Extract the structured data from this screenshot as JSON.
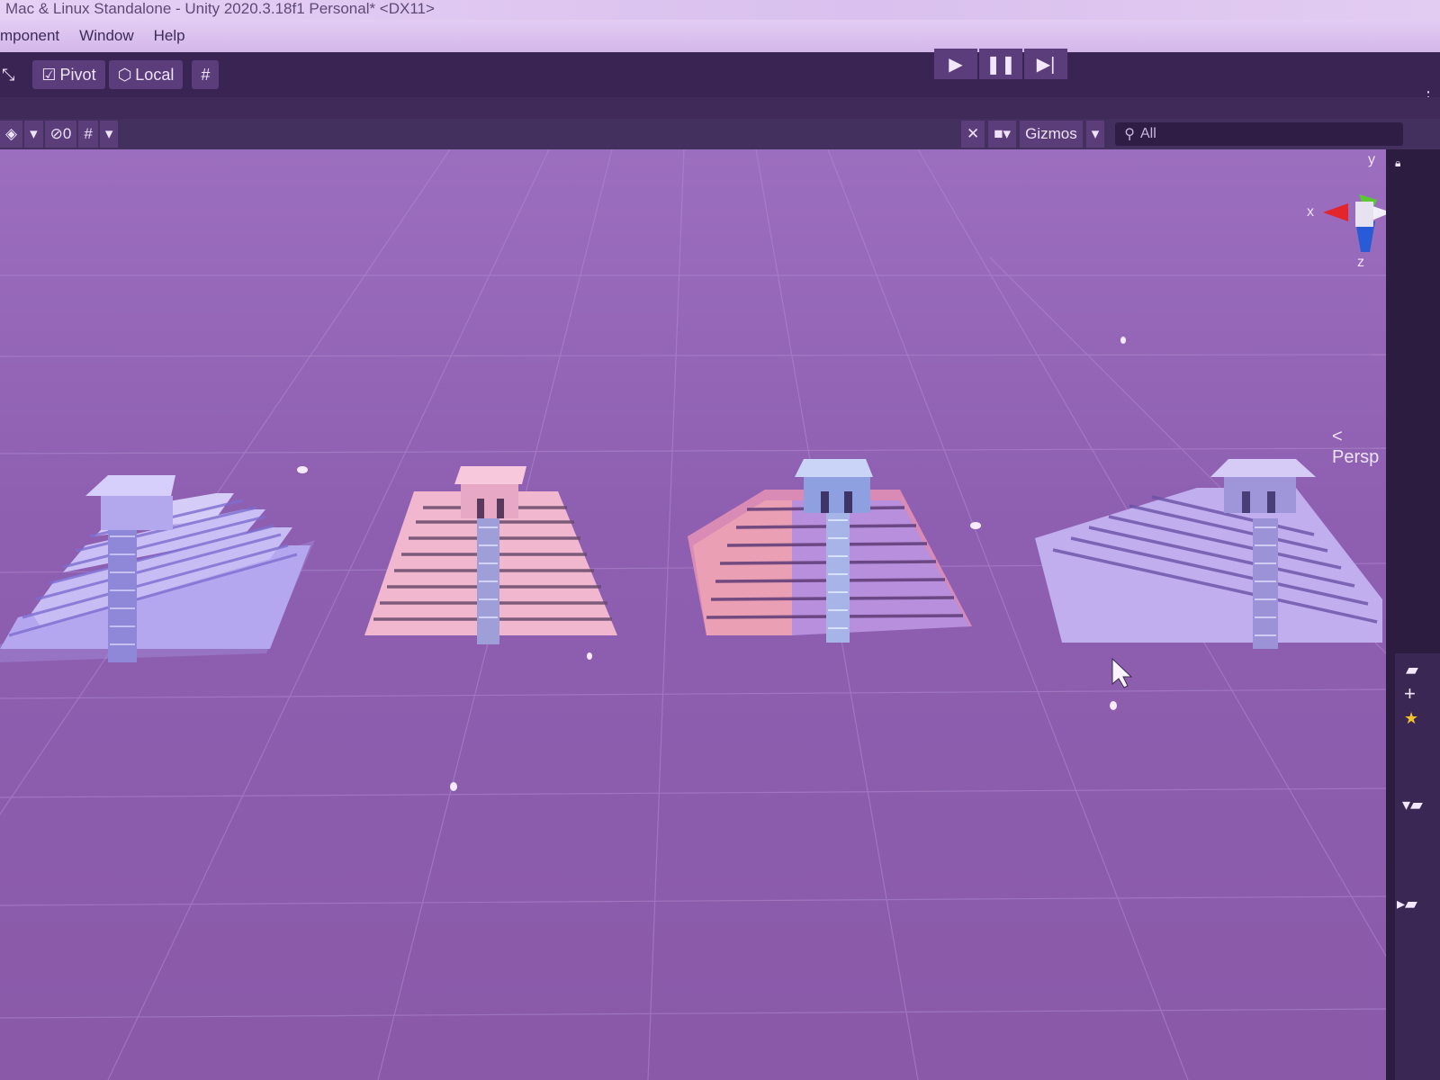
{
  "window": {
    "title": "Mac & Linux Standalone - Unity 2020.3.18f1 Personal* <DX11>"
  },
  "menu": {
    "items": [
      "mponent",
      "Window",
      "Help"
    ]
  },
  "toolbar": {
    "pivot_label": "Pivot",
    "local_label": "Local"
  },
  "scene_toolbar": {
    "hidden_count": "0",
    "gizmos_label": "Gizmos",
    "search_placeholder": "All"
  },
  "orientation_gizmo": {
    "x_label": "x",
    "y_label": "y",
    "z_label": "z",
    "projection_label": "Persp"
  },
  "scene": {
    "objects": [
      {
        "name": "pyramid",
        "tint": "#b5a7ef"
      },
      {
        "name": "pyramid",
        "tint": "#f3b9cf"
      },
      {
        "name": "pyramid",
        "tint": "#e48fa9"
      },
      {
        "name": "pyramid",
        "tint": "#c9b3f0"
      }
    ]
  },
  "colors": {
    "viewport_bg": "#8e5fb1",
    "toolbar_bg": "#3a2454",
    "axis_x": "#e3262c",
    "axis_y": "#5cc932",
    "axis_z": "#2a5bd7"
  }
}
